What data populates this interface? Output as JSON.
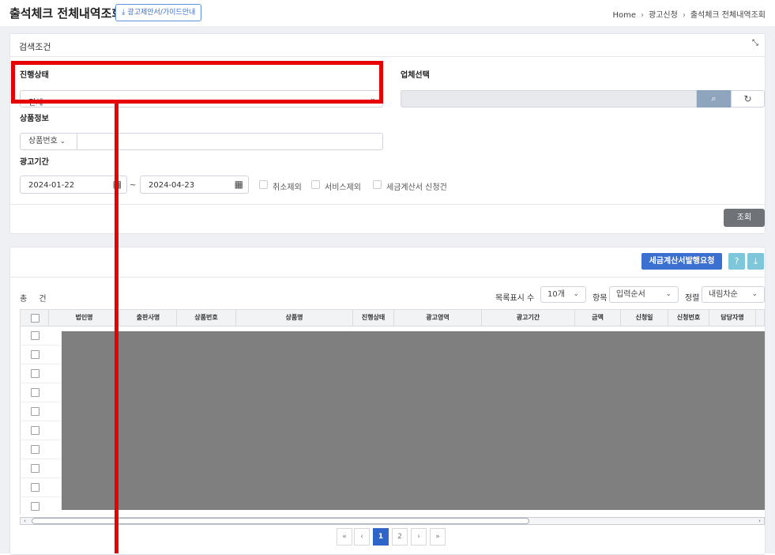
{
  "header": {
    "title": "출석체크 전체내역조회",
    "guide_button": "광고제안서/가이드안내",
    "breadcrumb": [
      "Home",
      "광고신청",
      "출석체크 전체내역조회"
    ]
  },
  "search_panel": {
    "title": "검색조건",
    "status_label": "진행상태",
    "status_value": "전체",
    "company_label": "업체선택",
    "company_value": "",
    "product_label": "상품정보",
    "product_select": "상품번호",
    "product_value": "",
    "period_label": "광고기간",
    "date_from": "2024-01-22",
    "date_to": "2024-04-23",
    "tilde": "~",
    "checkboxes": [
      {
        "label": "취소제외",
        "checked": false
      },
      {
        "label": "서비스제외",
        "checked": false
      },
      {
        "label": "세금계산서 신청건",
        "checked": false
      }
    ],
    "search_button": "조회"
  },
  "results_panel": {
    "invoice_button": "세금계산서발행요청",
    "total_label": "총 건",
    "page_size_label": "목록표시 수",
    "page_size_value": "10개",
    "sort_item_label": "항목",
    "sort_item_value": "입력순서",
    "sort_order_label": "정렬",
    "sort_order_value": "내림차순",
    "columns": [
      "법인명",
      "출판사명",
      "상품번호",
      "상품명",
      "진행상태",
      "광고영역",
      "광고기간",
      "금액",
      "신청일",
      "신청번호",
      "담당자명"
    ],
    "pagination": [
      "«",
      "‹",
      "1",
      "2",
      "›",
      "»"
    ],
    "current_page": "1"
  },
  "icons": {
    "download": "download-icon",
    "collapse": "collapse-icon",
    "search": "search-icon",
    "refresh": "refresh-icon",
    "calendar": "calendar-icon",
    "help": "help-icon"
  },
  "colors": {
    "primary": "#3b6fd0",
    "highlight": "#e60000",
    "masked": "#7f7f7f"
  }
}
